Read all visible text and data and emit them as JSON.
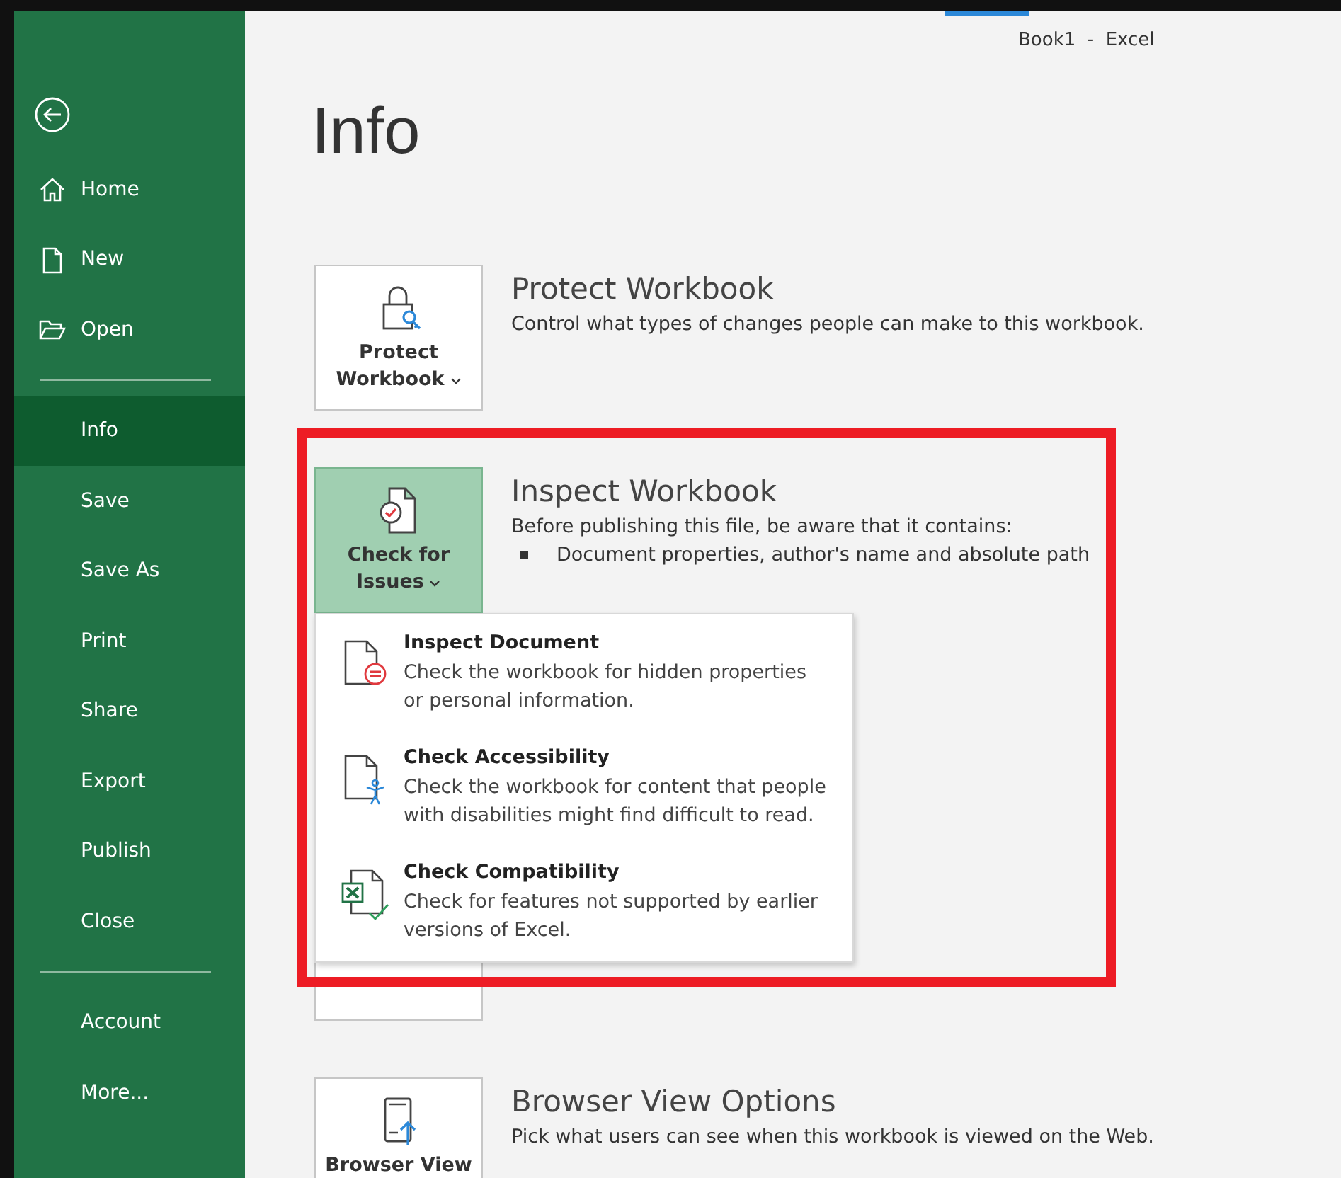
{
  "window": {
    "title": "Book1  -  Excel"
  },
  "sidebar": {
    "groups": [
      [
        {
          "label": "Home",
          "selected": false
        },
        {
          "label": "New",
          "selected": false
        },
        {
          "label": "Open",
          "selected": false
        }
      ],
      [
        {
          "label": "Info",
          "selected": true
        },
        {
          "label": "Save",
          "selected": false
        },
        {
          "label": "Save As",
          "selected": false
        },
        {
          "label": "Print",
          "selected": false
        },
        {
          "label": "Share",
          "selected": false
        },
        {
          "label": "Export",
          "selected": false
        },
        {
          "label": "Publish",
          "selected": false
        },
        {
          "label": "Close",
          "selected": false
        }
      ],
      [
        {
          "label": "Account",
          "selected": false
        },
        {
          "label": "More...",
          "selected": false
        }
      ]
    ]
  },
  "page_title": "Info",
  "sections": [
    {
      "kind": "protect",
      "heading": "Protect Workbook",
      "description": "Control what types of changes people can make to this workbook.",
      "button": {
        "lines": [
          "Protect",
          "Workbook"
        ],
        "dropdown": true,
        "expanded": false
      }
    },
    {
      "kind": "inspect",
      "heading": "Inspect Workbook",
      "description": "Before publishing this file, be aware that it contains:",
      "bullets": [
        "Document properties, author's name and absolute path"
      ],
      "button": {
        "lines": [
          "Check for",
          "Issues"
        ],
        "dropdown": true,
        "expanded": true
      },
      "menu": [
        {
          "kind": "inspect",
          "title": "Inspect Document",
          "description": "Check the workbook for hidden properties or personal information."
        },
        {
          "kind": "accessibility",
          "title": "Check Accessibility",
          "description": "Check the workbook for content that people with disabilities might find difficult to read."
        },
        {
          "kind": "compatibility",
          "title": "Check Compatibility",
          "description": "Check for features not supported by earlier versions of Excel."
        }
      ]
    },
    {
      "kind": "manage",
      "button": {
        "expanded": false
      }
    },
    {
      "kind": "browser",
      "heading": "Browser View Options",
      "description": "Pick what users can see when this workbook is viewed on the Web.",
      "button": {
        "lines": [
          "Browser View"
        ],
        "dropdown": false,
        "expanded": false
      }
    }
  ]
}
